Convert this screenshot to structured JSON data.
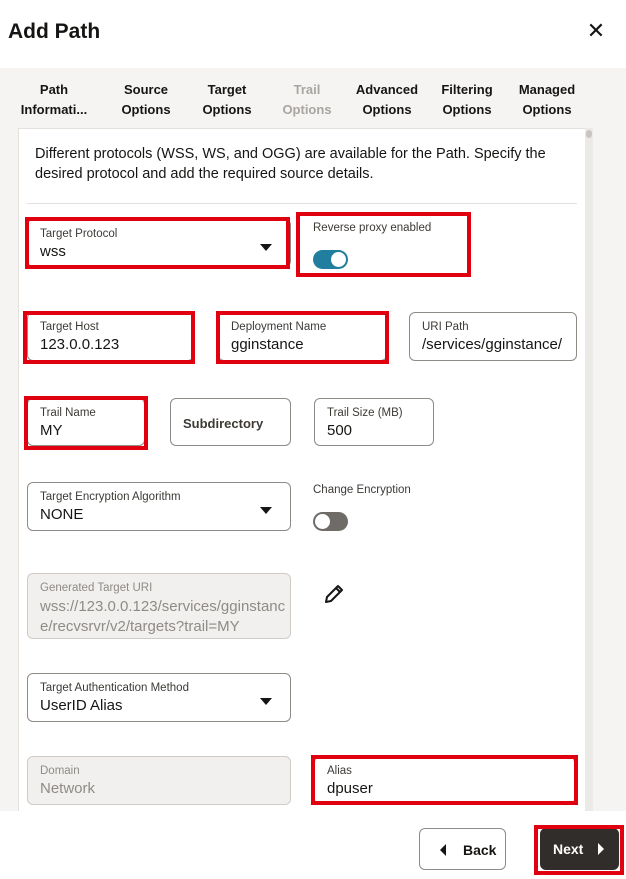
{
  "dialog": {
    "title": "Add Path",
    "close_glyph": "✕"
  },
  "tabs": [
    {
      "line1": "Path",
      "line2": "Informati...",
      "disabled": false
    },
    {
      "line1": "Source",
      "line2": "Options",
      "disabled": false
    },
    {
      "line1": "Target",
      "line2": "Options",
      "disabled": false
    },
    {
      "line1": "Trail",
      "line2": "Options",
      "disabled": true
    },
    {
      "line1": "Advanced",
      "line2": "Options",
      "disabled": false
    },
    {
      "line1": "Filtering",
      "line2": "Options",
      "disabled": false
    },
    {
      "line1": "Managed",
      "line2": "Options",
      "disabled": false
    }
  ],
  "description": "Different protocols (WSS, WS, and OGG) are available for the Path. Specify the desired protocol and add the required source details.",
  "form": {
    "target_protocol": {
      "label": "Target Protocol",
      "value": "wss"
    },
    "reverse_proxy": {
      "label": "Reverse proxy enabled",
      "enabled": true
    },
    "target_host": {
      "label": "Target Host",
      "value": "123.0.0.123"
    },
    "deployment_name": {
      "label": "Deployment Name",
      "value": "gginstance"
    },
    "uri_path": {
      "label": "URI Path",
      "value": "/services/gginstance/"
    },
    "trail_name": {
      "label": "Trail Name",
      "value": "MY"
    },
    "subdirectory": {
      "placeholder": "Subdirectory"
    },
    "trail_size": {
      "label": "Trail Size (MB)",
      "value": "500"
    },
    "encryption_algorithm": {
      "label": "Target Encryption Algorithm",
      "value": "NONE"
    },
    "change_encryption": {
      "label": "Change Encryption",
      "enabled": false
    },
    "generated_uri": {
      "label": "Generated Target URI",
      "value": "wss://123.0.0.123/services/gginstance/recvsrvr/v2/targets?trail=MY"
    },
    "auth_method": {
      "label": "Target Authentication Method",
      "value": "UserID Alias"
    },
    "domain": {
      "label": "Domain",
      "value": "Network"
    },
    "alias": {
      "label": "Alias",
      "value": "dpuser"
    }
  },
  "footer": {
    "back_label": "Back",
    "next_label": "Next"
  },
  "colors": {
    "accent": "#227e9e",
    "highlight": "#e1000f",
    "primary_button": "#312d2a"
  },
  "icons": {
    "close": "close-icon",
    "edit": "pencil-icon",
    "dropdown": "chevron-down-icon"
  }
}
